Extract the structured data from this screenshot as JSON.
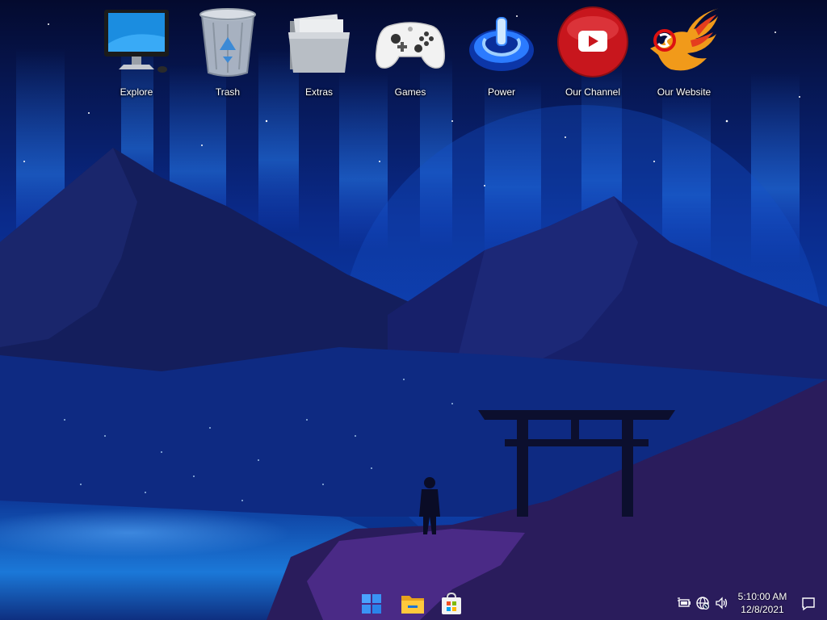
{
  "desktop": {
    "icons": [
      {
        "label": "Explore"
      },
      {
        "label": "Trash"
      },
      {
        "label": "Extras"
      },
      {
        "label": "Games"
      },
      {
        "label": "Power"
      },
      {
        "label": "Our Channel"
      },
      {
        "label": "Our Website"
      }
    ]
  },
  "taskbar": {
    "apps": [
      {
        "icon": "windows-start-icon"
      },
      {
        "icon": "file-explorer-icon"
      },
      {
        "icon": "microsoft-store-icon"
      }
    ],
    "tray": {
      "icons": [
        "battery-icon",
        "network-icon",
        "volume-icon"
      ],
      "time": "5:10:00 AM",
      "date": "12/8/2021"
    }
  },
  "colors": {
    "sky": "#0a2a8a",
    "aurora": "#1e6dff",
    "mountain": "#141e5c",
    "ground": "#3a1f6e"
  }
}
